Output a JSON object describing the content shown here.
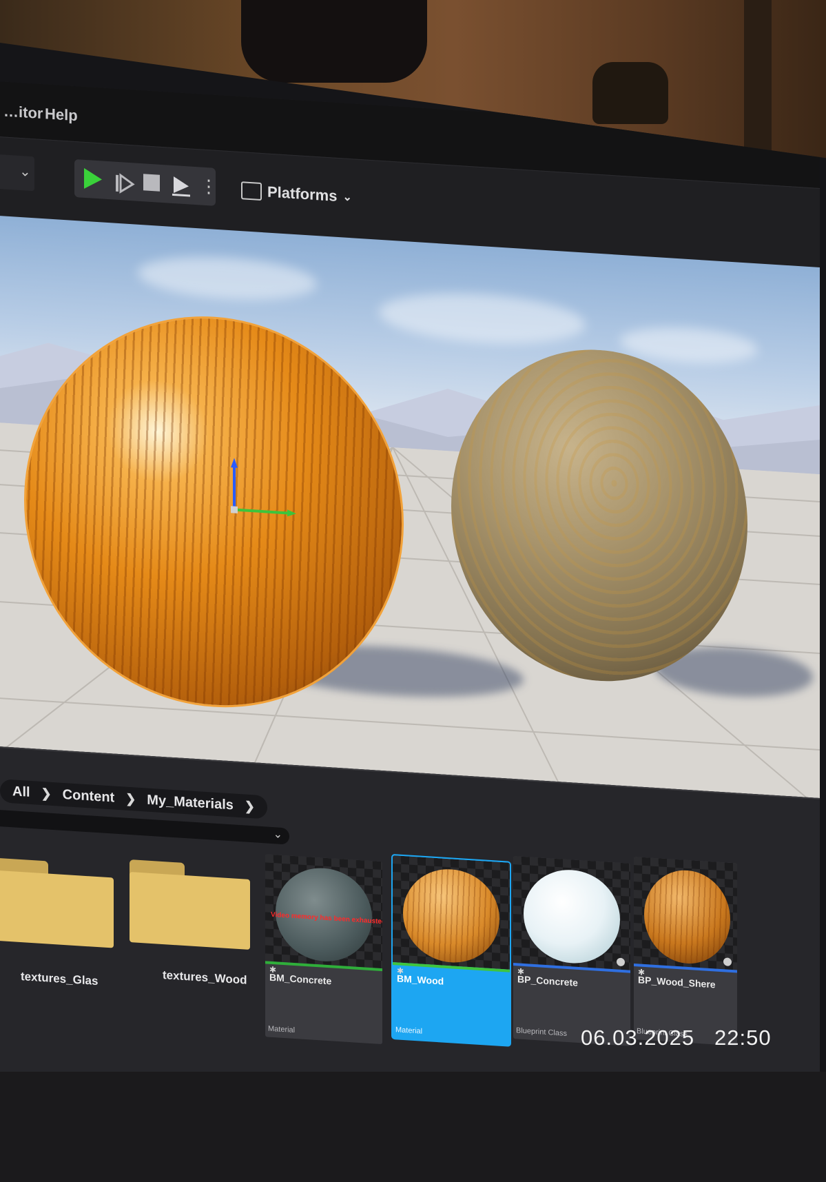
{
  "menu": {
    "items": [
      "…itor",
      "Help"
    ]
  },
  "toolbar": {
    "platforms_label": "Platforms",
    "play_icon": "play-icon",
    "advance_icon": "advance-frame-icon",
    "stop_icon": "stop-icon",
    "eject_icon": "eject-icon",
    "more_icon": "more-options-icon"
  },
  "viewport": {
    "objects": [
      "wood-sphere",
      "concrete-sphere"
    ],
    "selected": "wood-sphere"
  },
  "content_browser": {
    "breadcrumb": [
      "All",
      "Content",
      "My_Materials"
    ],
    "folders": [
      {
        "label": "textures_Glas"
      },
      {
        "label": "textures_Wood"
      }
    ],
    "assets": [
      {
        "name": "BM_Concrete",
        "type": "Material",
        "warning": "Video memory has been exhausted (1342)",
        "color": "#4b5a5c",
        "bar": "#2fae3a"
      },
      {
        "name": "BM_Wood",
        "type": "Material",
        "color": "#d98a2a",
        "bar": "#22a2ee",
        "selected": true
      },
      {
        "name": "BP_Concrete",
        "type": "Blueprint Class",
        "color": "#e8f2f6",
        "bar": "#2f6fe0"
      },
      {
        "name": "BP_Wood_Shere",
        "type": "Blueprint Class",
        "color": "#c9781e",
        "bar": "#2f6fe0"
      }
    ]
  },
  "timestamp": {
    "date": "06.03.2025",
    "time": "22:50"
  },
  "colors": {
    "accent_select": "#22a2ee",
    "play_green": "#3ad13a",
    "folder": "#e4c26a"
  }
}
